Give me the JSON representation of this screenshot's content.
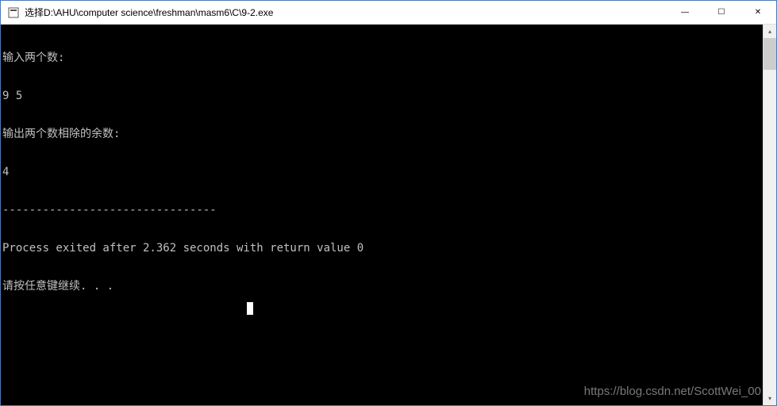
{
  "window": {
    "title": "选择D:\\AHU\\computer science\\freshman\\masm6\\C\\9-2.exe"
  },
  "console": {
    "lines": [
      "输入两个数:",
      "9 5",
      "输出两个数相除的余数:",
      "4",
      "--------------------------------",
      "Process exited after 2.362 seconds with return value 0",
      "请按任意键继续. . ."
    ]
  },
  "controls": {
    "minimize": "—",
    "maximize": "☐",
    "close": "✕",
    "scroll_up": "▴",
    "scroll_down": "▾"
  },
  "watermark": "https://blog.csdn.net/ScottWei_00"
}
